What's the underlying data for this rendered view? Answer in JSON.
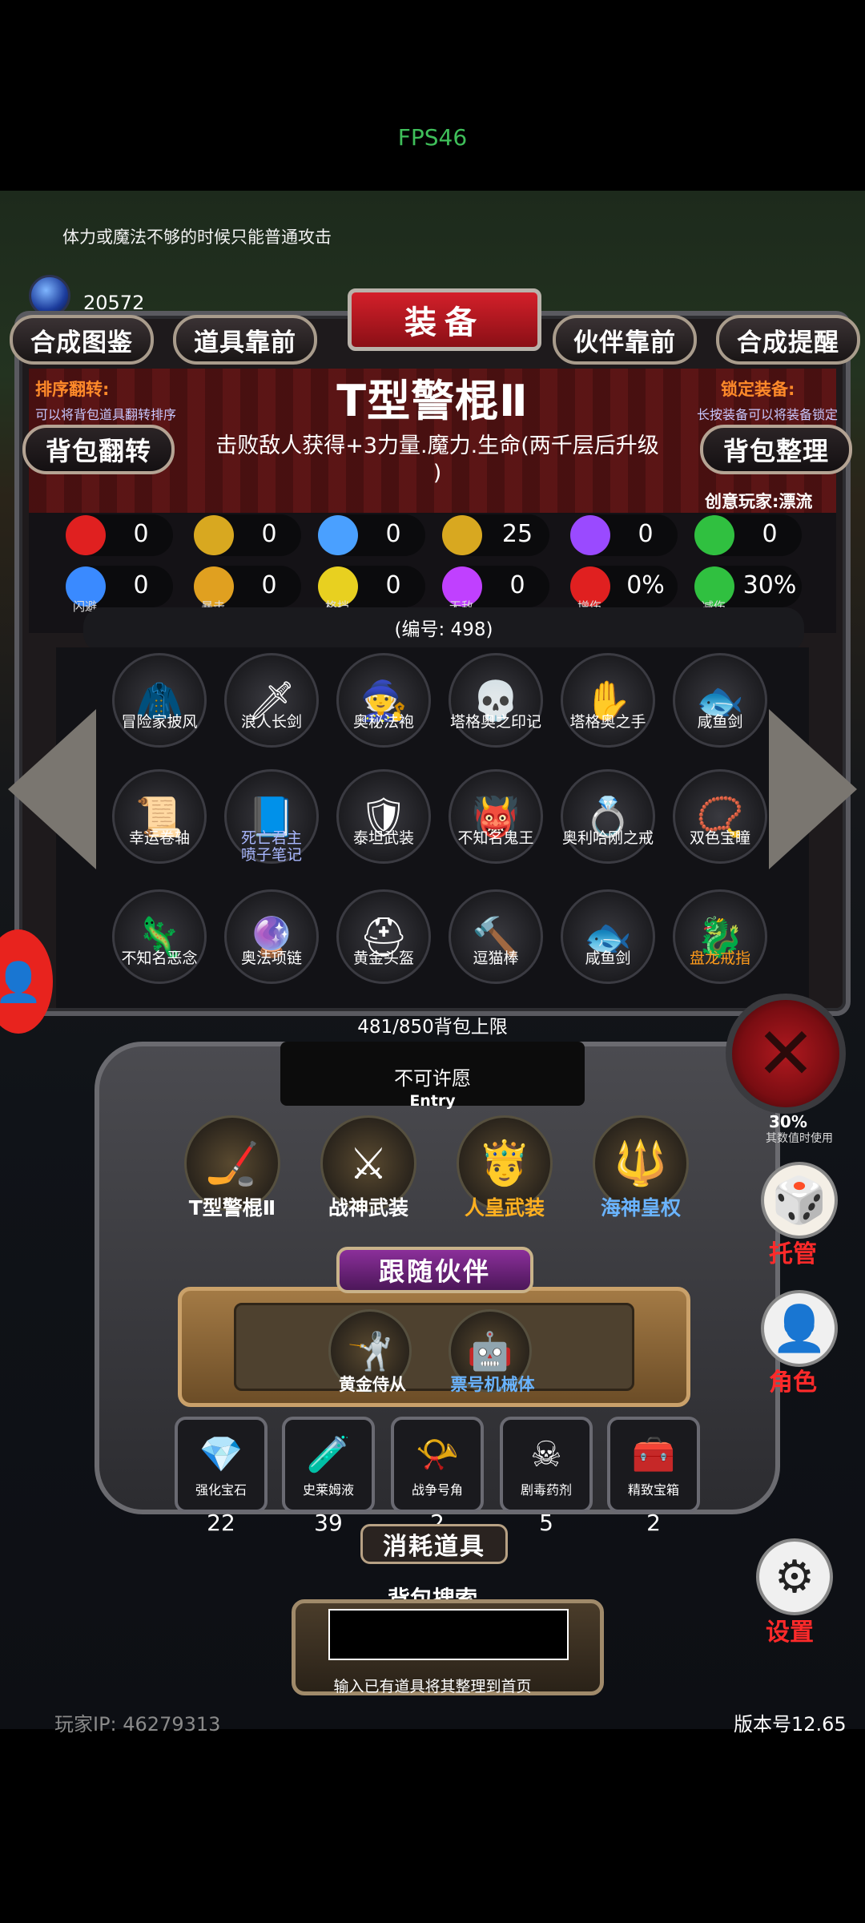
{
  "status": {
    "fps": "FPS46"
  },
  "hint": "体力或魔法不够的时候只能普通攻击",
  "currency": {
    "icon": "blue-gem-icon",
    "amount": "20572"
  },
  "top_buttons": {
    "synth_atlas": "合成图鉴",
    "items_front": "道具靠前",
    "title": "装备",
    "partner_front": "伙伴靠前",
    "synth_remind": "合成提醒"
  },
  "sort_flip": {
    "label": "排序翻转:",
    "note": "可以将背包道具翻转排序",
    "button": "背包翻转"
  },
  "lock_equip": {
    "label": "锁定装备:",
    "note": "长按装备可以将装备锁定",
    "button": "背包整理"
  },
  "item": {
    "name": "T型警棍Ⅱ",
    "desc_line1": "击败敌人获得+3力量.魔力.生命(两千层后升级",
    "desc_line2": ")",
    "creator": "创意玩家:漂流",
    "number": "(编号: 498)"
  },
  "stats_row1": [
    {
      "icon": "heart-icon",
      "value": "0",
      "color": "#e02020"
    },
    {
      "icon": "armor-icon",
      "value": "0",
      "color": "#d8a820"
    },
    {
      "icon": "boot-icon",
      "value": "0",
      "color": "#4aa0ff"
    },
    {
      "icon": "magic-staff-icon",
      "value": "25",
      "color": "#d8a820"
    },
    {
      "icon": "lightning-icon",
      "value": "0",
      "color": "#9a4aff"
    },
    {
      "icon": "clover-icon",
      "value": "0",
      "color": "#30c040"
    }
  ],
  "stats_row2": [
    {
      "icon": "dodge-icon",
      "value": "0",
      "label": "闪避",
      "color": "#3a8aff"
    },
    {
      "icon": "crit-icon",
      "value": "0",
      "label": "暴击",
      "color": "#e0a020"
    },
    {
      "icon": "shield-icon",
      "value": "0",
      "label": "格挡",
      "color": "#e8d020"
    },
    {
      "icon": "wings-icon",
      "value": "0",
      "label": "无敌",
      "color": "#c040ff"
    },
    {
      "icon": "swords-icon",
      "value": "0%",
      "label": "增伤",
      "color": "#e02020"
    },
    {
      "icon": "green-shield-icon",
      "value": "30%",
      "label": "减伤",
      "color": "#30c040"
    }
  ],
  "inventory": [
    {
      "label": "冒险家披风",
      "icon": "🧥",
      "style": ""
    },
    {
      "label": "浪人长剑",
      "icon": "🗡",
      "style": ""
    },
    {
      "label": "奥秘法袍",
      "icon": "🧙",
      "style": ""
    },
    {
      "label": "塔格奥之印记",
      "icon": "💀",
      "style": ""
    },
    {
      "label": "塔格奥之手",
      "icon": "✋",
      "style": ""
    },
    {
      "label": "咸鱼剑",
      "icon": "🐟",
      "style": ""
    },
    {
      "label": "幸运卷轴",
      "icon": "📜",
      "style": ""
    },
    {
      "label": "死亡君主\n喷子笔记",
      "icon": "📘",
      "style": "blue"
    },
    {
      "label": "泰坦武装",
      "icon": "🛡",
      "style": ""
    },
    {
      "label": "不知名鬼王",
      "icon": "👹",
      "style": ""
    },
    {
      "label": "奥利哈刚之戒",
      "icon": "💍",
      "style": ""
    },
    {
      "label": "双色宝瞳",
      "icon": "📿",
      "style": ""
    },
    {
      "label": "不知名恶念",
      "icon": "🦎",
      "style": ""
    },
    {
      "label": "奥法项链",
      "icon": "🔮",
      "style": ""
    },
    {
      "label": "黄金头盔",
      "icon": "⛑",
      "style": ""
    },
    {
      "label": "逗猫棒",
      "icon": "🔨",
      "style": ""
    },
    {
      "label": "咸鱼剑",
      "icon": "🐟",
      "style": ""
    },
    {
      "label": "盘龙戒指",
      "icon": "🐉",
      "style": "orange"
    }
  ],
  "capacity": "481/850背包上限",
  "wish": {
    "title": "不可许愿",
    "entry": "Entry"
  },
  "equipped": [
    {
      "label": "T型警棍Ⅱ",
      "icon": "🏒",
      "color": "#ffffff"
    },
    {
      "label": "战神武装",
      "icon": "⚔",
      "color": "#ffffff"
    },
    {
      "label": "人皇武装",
      "icon": "🤴",
      "color": "#ffb020"
    },
    {
      "label": "海神皇权",
      "icon": "🔱",
      "color": "#6ab4ff"
    }
  ],
  "follow": {
    "banner": "跟随伙伴",
    "companions": [
      {
        "label": "黄金侍从",
        "icon": "🤺",
        "color": "#ffffff"
      },
      {
        "label": "票号机械体",
        "icon": "🤖",
        "color": "#6ab4ff"
      }
    ]
  },
  "consumables": [
    {
      "label": "强化宝石",
      "icon": "💎",
      "count": "22"
    },
    {
      "label": "史莱姆液",
      "icon": "🧪",
      "count": "39"
    },
    {
      "label": "战争号角",
      "icon": "📯",
      "count": "2"
    },
    {
      "label": "剧毒药剂",
      "icon": "☠",
      "count": "5"
    },
    {
      "label": "精致宝箱",
      "icon": "🧰",
      "count": "2"
    }
  ],
  "consume_banner": "消耗道具",
  "search": {
    "title": "背包搜索",
    "value": "",
    "hint": "输入已有道具将其整理到首页"
  },
  "footer": {
    "player_ip": "玩家IP: 46279313",
    "version": "版本号12.65"
  },
  "side_controls": {
    "close_icon": "close-x-icon",
    "percent": "30%",
    "percent_note": "其数值时使用",
    "manage_label": "托管",
    "role_label": "角色",
    "settings_label": "设置"
  }
}
